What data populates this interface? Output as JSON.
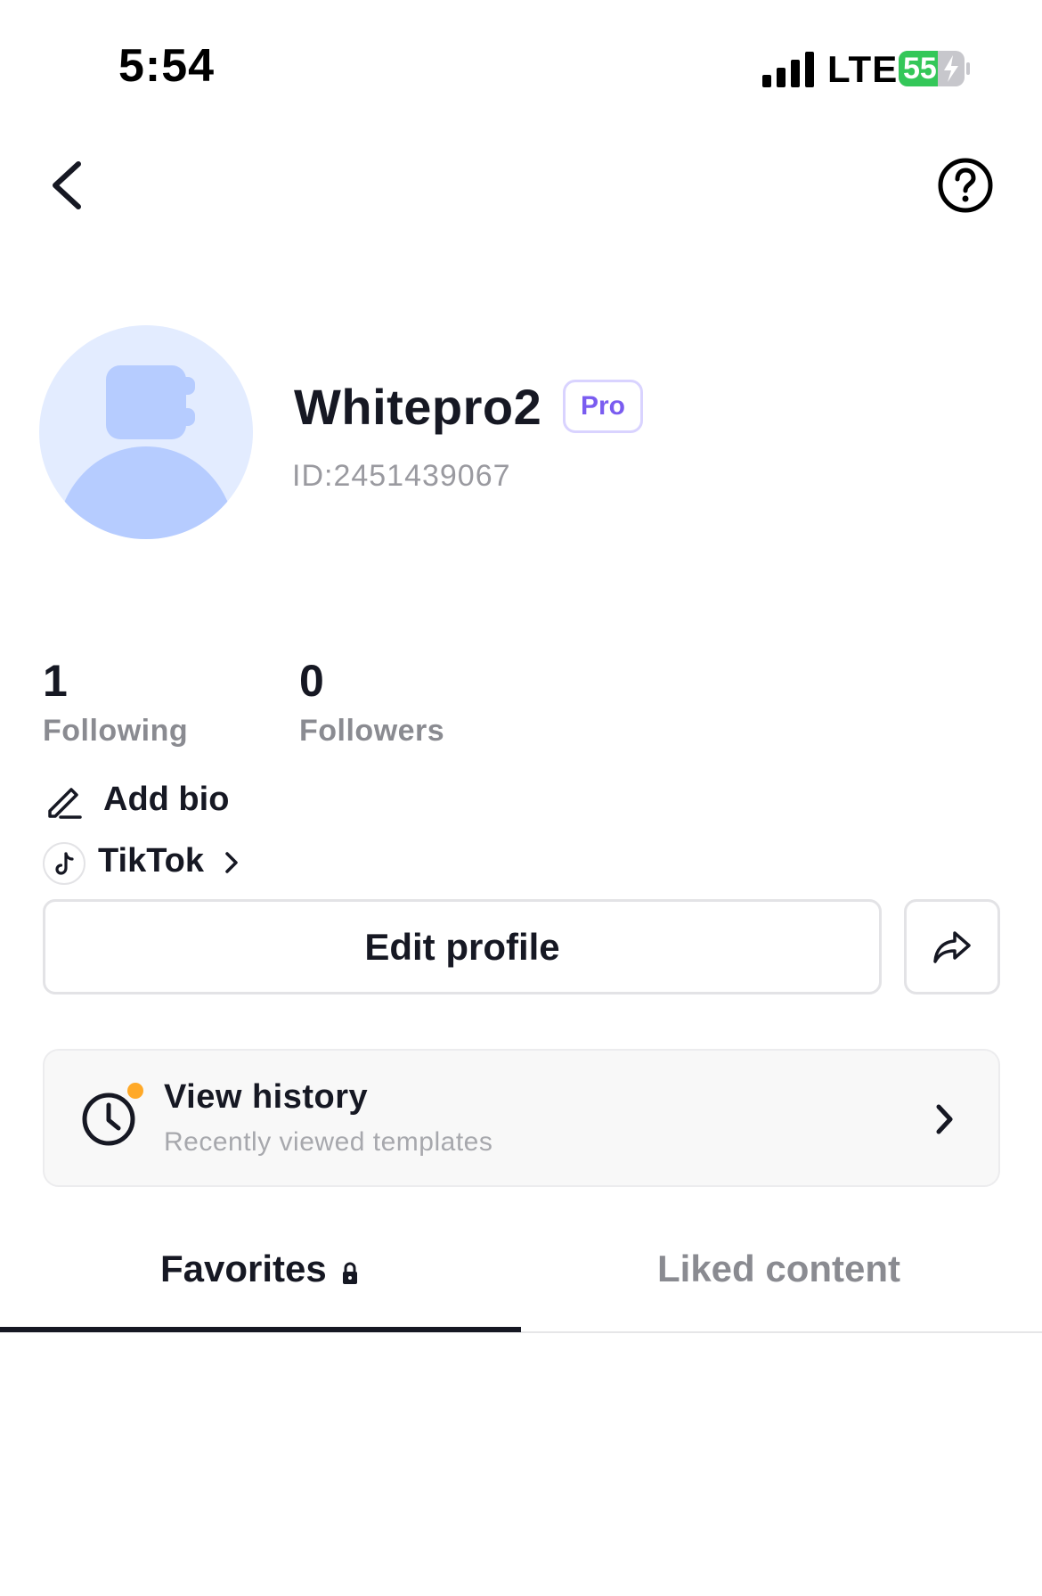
{
  "status_bar": {
    "time": "5:54",
    "network": "LTE",
    "battery": "55"
  },
  "header": {
    "back_icon": "chevron-left-icon",
    "help_icon": "question-circle-icon"
  },
  "profile": {
    "username": "Whitepro2",
    "badge": "Pro",
    "id_text": "ID:2451439067",
    "avatar_icon": "default-avatar"
  },
  "stats": [
    {
      "value": "1",
      "label": "Following"
    },
    {
      "value": "0",
      "label": "Followers"
    }
  ],
  "bio": {
    "label": "Add bio",
    "icon": "pencil-icon"
  },
  "linked": {
    "label": "TikTok",
    "icon": "tiktok-icon"
  },
  "actions": {
    "edit_label": "Edit profile",
    "share_icon": "share-arrow-icon"
  },
  "history": {
    "title": "View history",
    "subtitle": "Recently viewed templates",
    "icon": "clock-icon"
  },
  "tabs": [
    {
      "label": "Favorites",
      "active": true,
      "locked": true
    },
    {
      "label": "Liked content",
      "active": false
    }
  ],
  "colors": {
    "accent_badge": "#7a5cf0",
    "indicator_dot": "#ffa928",
    "battery_green": "#34c759",
    "avatar_bg": "#e3ecff",
    "avatar_fg": "#b6ccff"
  }
}
